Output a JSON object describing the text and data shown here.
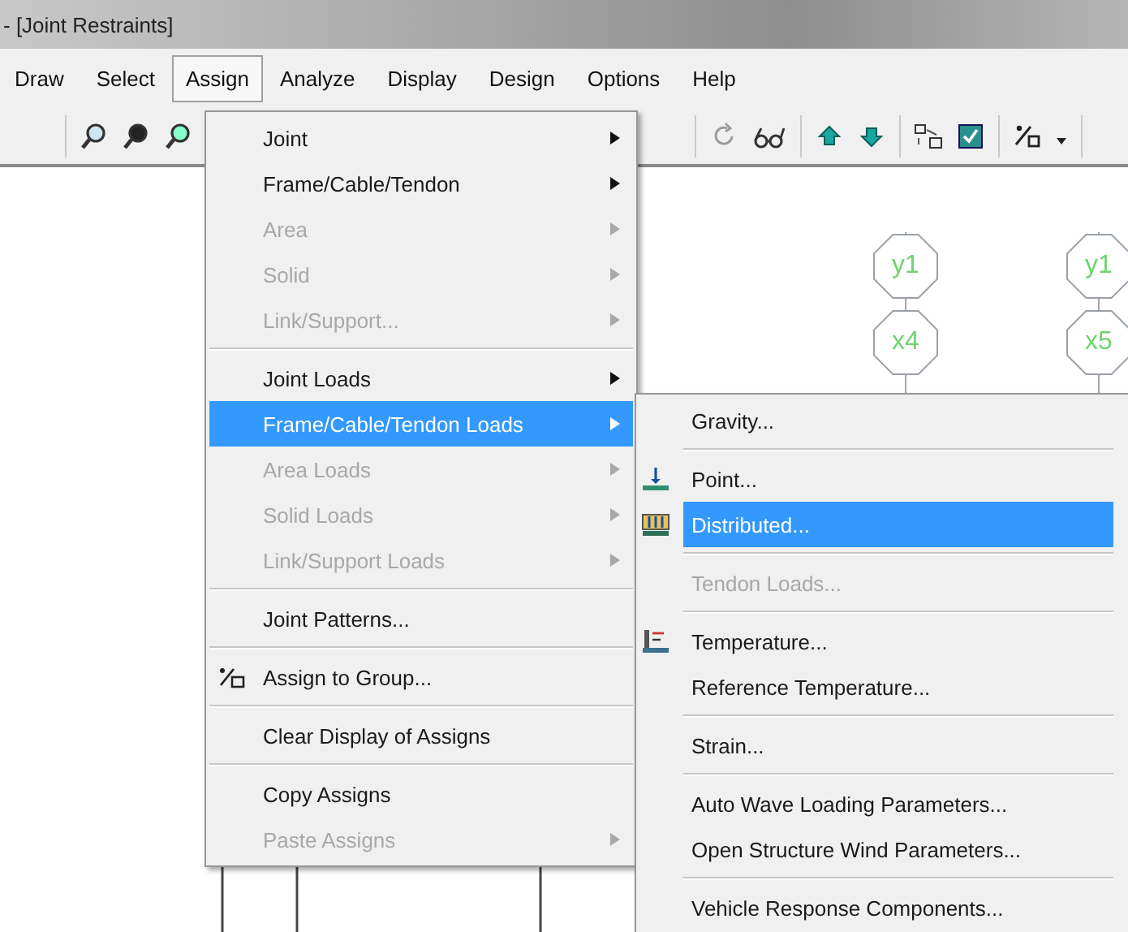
{
  "window": {
    "title": "- [Joint Restraints]"
  },
  "menu_bar": [
    {
      "label": "Draw",
      "selected": false
    },
    {
      "label": "Select",
      "selected": false
    },
    {
      "label": "Assign",
      "selected": true
    },
    {
      "label": "Analyze",
      "selected": false
    },
    {
      "label": "Display",
      "selected": false
    },
    {
      "label": "Design",
      "selected": false
    },
    {
      "label": "Options",
      "selected": false
    },
    {
      "label": "Help",
      "selected": false
    }
  ],
  "canvas": {
    "joint_labels": [
      "y1",
      "x4",
      "y1",
      "x5"
    ]
  },
  "assign_menu": {
    "items": [
      {
        "kind": "item",
        "label": "Joint",
        "disabled": false,
        "submenu": true,
        "selected": false
      },
      {
        "kind": "item",
        "label": "Frame/Cable/Tendon",
        "disabled": false,
        "submenu": true,
        "selected": false
      },
      {
        "kind": "item",
        "label": "Area",
        "disabled": true,
        "submenu": true,
        "selected": false
      },
      {
        "kind": "item",
        "label": "Solid",
        "disabled": true,
        "submenu": true,
        "selected": false
      },
      {
        "kind": "item",
        "label": "Link/Support...",
        "disabled": true,
        "submenu": true,
        "selected": false
      },
      {
        "kind": "separator"
      },
      {
        "kind": "item",
        "label": "Joint Loads",
        "disabled": false,
        "submenu": true,
        "selected": false
      },
      {
        "kind": "item",
        "label": "Frame/Cable/Tendon Loads",
        "disabled": false,
        "submenu": true,
        "selected": true
      },
      {
        "kind": "item",
        "label": "Area Loads",
        "disabled": true,
        "submenu": true,
        "selected": false
      },
      {
        "kind": "item",
        "label": "Solid Loads",
        "disabled": true,
        "submenu": true,
        "selected": false
      },
      {
        "kind": "item",
        "label": "Link/Support Loads",
        "disabled": true,
        "submenu": true,
        "selected": false
      },
      {
        "kind": "separator"
      },
      {
        "kind": "item",
        "label": "Joint Patterns...",
        "disabled": false,
        "submenu": false,
        "selected": false
      },
      {
        "kind": "separator"
      },
      {
        "kind": "group",
        "label": "Assign to Group...",
        "disabled": false,
        "submenu": false,
        "selected": false
      },
      {
        "kind": "separator"
      },
      {
        "kind": "item",
        "label": "Clear Display of Assigns",
        "disabled": false,
        "submenu": false,
        "selected": false
      },
      {
        "kind": "separator"
      },
      {
        "kind": "item",
        "label": "Copy Assigns",
        "disabled": false,
        "submenu": false,
        "selected": false
      },
      {
        "kind": "item",
        "label": "Paste Assigns",
        "disabled": true,
        "submenu": true,
        "selected": false
      }
    ]
  },
  "loads_submenu": {
    "items": [
      {
        "kind": "item",
        "label": "Gravity...",
        "disabled": false,
        "selected": false
      },
      {
        "kind": "separator"
      },
      {
        "kind": "point",
        "label": "Point...",
        "disabled": false,
        "selected": false
      },
      {
        "kind": "distributed",
        "label": "Distributed...",
        "disabled": false,
        "selected": true
      },
      {
        "kind": "separator"
      },
      {
        "kind": "item",
        "label": "Tendon Loads...",
        "disabled": true,
        "selected": false
      },
      {
        "kind": "separator"
      },
      {
        "kind": "temperature",
        "label": "Temperature...",
        "disabled": false,
        "selected": false
      },
      {
        "kind": "item",
        "label": "Reference Temperature...",
        "disabled": false,
        "selected": false
      },
      {
        "kind": "separator"
      },
      {
        "kind": "item",
        "label": "Strain...",
        "disabled": false,
        "selected": false
      },
      {
        "kind": "separator"
      },
      {
        "kind": "item",
        "label": "Auto Wave Loading Parameters...",
        "disabled": false,
        "selected": false
      },
      {
        "kind": "item",
        "label": "Open Structure Wind Parameters...",
        "disabled": false,
        "selected": false
      },
      {
        "kind": "separator"
      },
      {
        "kind": "item",
        "label": "Vehicle Response Components...",
        "disabled": false,
        "selected": false
      }
    ]
  }
}
